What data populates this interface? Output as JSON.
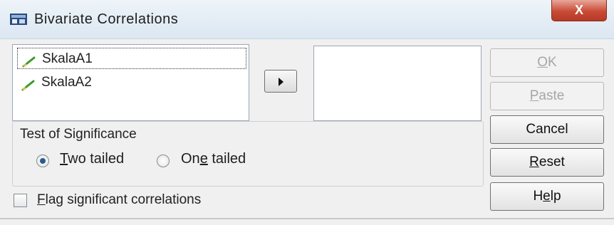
{
  "window": {
    "title": "Bivariate Correlations",
    "close_label": "X"
  },
  "variables": [
    {
      "label": "SkalaA1",
      "icon": "scale-variable-icon"
    },
    {
      "label": "SkalaA2",
      "icon": "scale-variable-icon"
    }
  ],
  "buttons": {
    "ok_mnemonic": "O",
    "ok_rest": "K",
    "paste_mnemonic": "P",
    "paste_rest": "aste",
    "cancel_label": "Cancel",
    "reset_mnemonic": "R",
    "reset_rest": "eset",
    "help_pre": "H",
    "help_mnemonic": "e",
    "help_rest": "lp"
  },
  "significance": {
    "legend": "Test of Significance",
    "two_tailed_mnemonic": "T",
    "two_tailed_rest": "wo tailed",
    "one_tailed_pre": "On",
    "one_tailed_mnemonic": "e",
    "one_tailed_rest": " tailed",
    "selected": "two_tailed"
  },
  "flag": {
    "mnemonic": "F",
    "rest": "lag significant correlations",
    "checked": false
  },
  "colors": {
    "radio_dot": "#2a5c8e",
    "close_button": "#c94b36"
  }
}
